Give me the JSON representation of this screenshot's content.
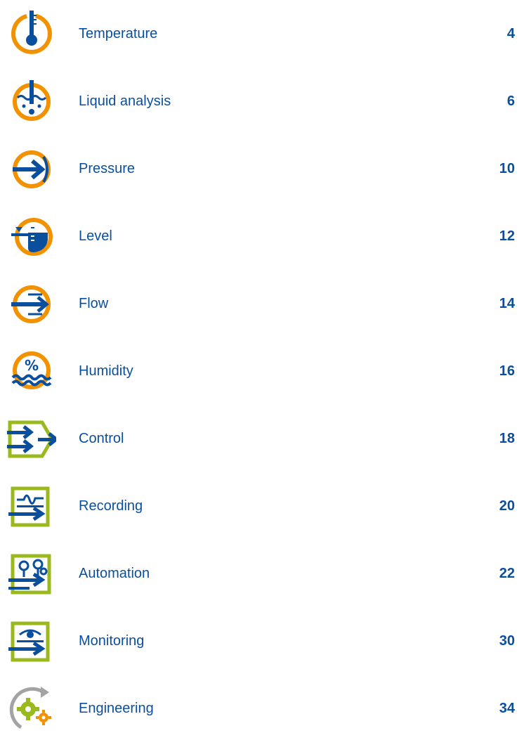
{
  "colors": {
    "orange": "#f39200",
    "green": "#9ab91e",
    "blue": "#0a4f9e",
    "gray": "#a3a3a3"
  },
  "entries": [
    {
      "label": "Temperature",
      "page": "4",
      "icon": "thermometer-icon"
    },
    {
      "label": "Liquid analysis",
      "page": "6",
      "icon": "liquid-analysis-icon"
    },
    {
      "label": "Pressure",
      "page": "10",
      "icon": "pressure-icon"
    },
    {
      "label": "Level",
      "page": "12",
      "icon": "level-icon"
    },
    {
      "label": "Flow",
      "page": "14",
      "icon": "flow-icon"
    },
    {
      "label": "Humidity",
      "page": "16",
      "icon": "humidity-icon"
    },
    {
      "label": "Control",
      "page": "18",
      "icon": "control-icon"
    },
    {
      "label": "Recording",
      "page": "20",
      "icon": "recording-icon"
    },
    {
      "label": "Automation",
      "page": "22",
      "icon": "automation-icon"
    },
    {
      "label": "Monitoring",
      "page": "30",
      "icon": "monitoring-icon"
    },
    {
      "label": "Engineering",
      "page": "34",
      "icon": "engineering-icon"
    }
  ]
}
